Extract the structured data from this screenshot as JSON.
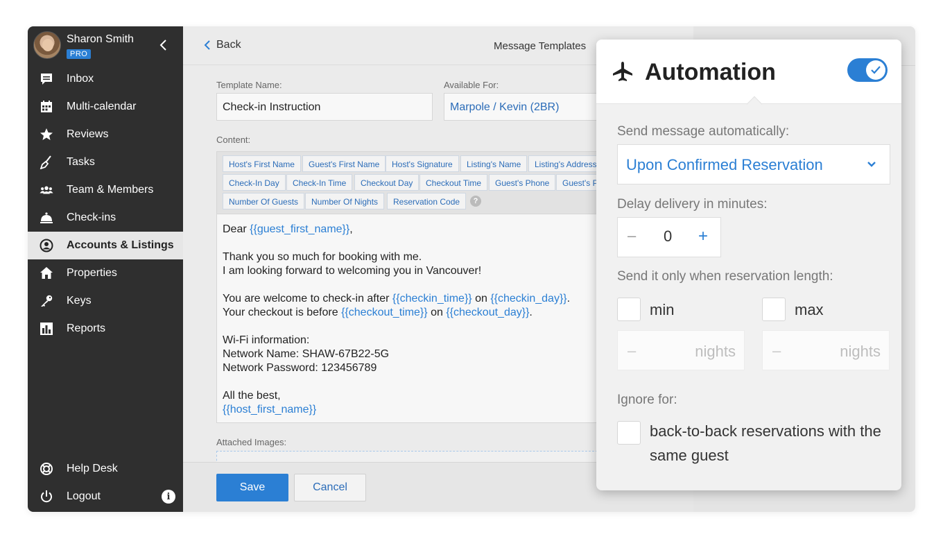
{
  "user": {
    "name": "Sharon Smith",
    "badge": "PRO"
  },
  "sidebar": {
    "items": [
      {
        "label": "Inbox",
        "icon": "inbox-icon"
      },
      {
        "label": "Multi-calendar",
        "icon": "calendar-icon"
      },
      {
        "label": "Reviews",
        "icon": "star-icon"
      },
      {
        "label": "Tasks",
        "icon": "broom-icon"
      },
      {
        "label": "Team & Members",
        "icon": "team-icon"
      },
      {
        "label": "Check-ins",
        "icon": "bell-icon"
      },
      {
        "label": "Accounts & Listings",
        "icon": "user-circle-icon",
        "active": true
      },
      {
        "label": "Properties",
        "icon": "home-icon"
      },
      {
        "label": "Keys",
        "icon": "key-icon"
      },
      {
        "label": "Reports",
        "icon": "bar-chart-icon"
      }
    ],
    "bottom": [
      {
        "label": "Help Desk",
        "icon": "lifebuoy-icon"
      },
      {
        "label": "Logout",
        "icon": "power-icon"
      }
    ]
  },
  "topbar": {
    "back_label": "Back",
    "title": "Message Templates"
  },
  "form": {
    "template_name_label": "Template Name:",
    "template_name_value": "Check-in Instruction",
    "available_for_label": "Available For:",
    "available_for_value": "Marpole / Kevin (2BR)",
    "content_label": "Content:",
    "tags_row1": [
      "Host's First Name",
      "Guest's First Name",
      "Host's Signature",
      "Listing's Name",
      "Listing's Address"
    ],
    "tags_row2": [
      "Check-In Day",
      "Check-In Time",
      "Checkout Day",
      "Checkout Time",
      "Guest's Phone",
      "Guest's P"
    ],
    "tags_row3": [
      "Number Of Guests",
      "Number Of Nights",
      "Reservation Code"
    ],
    "help_mark": "?",
    "attached_images_label": "Attached Images:"
  },
  "content": {
    "l1_text": "Dear ",
    "l1_var": "{{guest_first_name}}",
    "l1_end": ",",
    "l2": "Thank you so much for booking with me.",
    "l3": "I am looking forward to welcoming you in Vancouver!",
    "l4_text": "You are welcome to check-in after ",
    "l4_var1": "{{checkin_time}}",
    "l4_mid": " on ",
    "l4_var2": "{{checkin_day}}",
    "l4_end": ".",
    "l5_text": "Your checkout is before ",
    "l5_var1": "{{checkout_time}}",
    "l5_mid": " on ",
    "l5_var2": "{{checkout_day}}",
    "l5_end": ".",
    "l6": "Wi-Fi information:",
    "l7": "Network Name: SHAW-67B22-5G",
    "l8": "Network Password: 123456789",
    "l9": "All the best,",
    "l10_var": "{{host_first_name}}"
  },
  "footer": {
    "save_label": "Save",
    "cancel_label": "Cancel"
  },
  "automation": {
    "title": "Automation",
    "enabled": true,
    "send_label": "Send message automatically:",
    "send_value": "Upon Confirmed Reservation",
    "delay_label": "Delay delivery in minutes:",
    "delay_minus": "–",
    "delay_value": "0",
    "delay_plus": "+",
    "length_label": "Send it only when reservation length:",
    "min_label": "min",
    "max_label": "max",
    "min_dash": "–",
    "min_unit": "nights",
    "max_dash": "–",
    "max_unit": "nights",
    "ignore_label": "Ignore for:",
    "ignore_option": "back-to-back reservations with the same guest"
  },
  "colors": {
    "accent": "#2b7fd4",
    "sidebar_bg": "#2f2f2f"
  }
}
